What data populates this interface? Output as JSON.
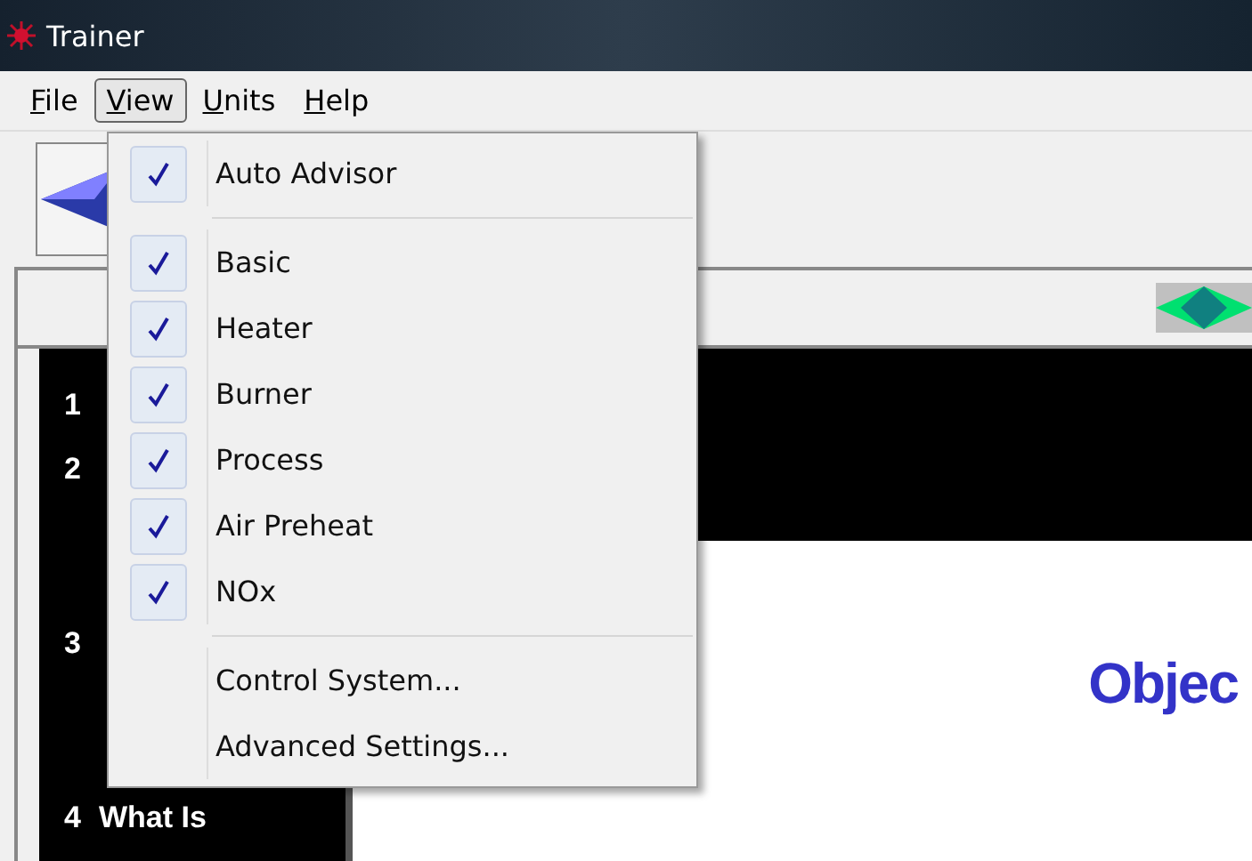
{
  "window": {
    "title": "Trainer"
  },
  "menubar": [
    {
      "label": "File",
      "selected": false
    },
    {
      "label": "View",
      "selected": true
    },
    {
      "label": "Units",
      "selected": false
    },
    {
      "label": "Help",
      "selected": false
    }
  ],
  "view_menu": [
    {
      "kind": "check",
      "label": "Auto Advisor",
      "checked": true
    },
    {
      "kind": "separator"
    },
    {
      "kind": "check",
      "label": "Basic",
      "checked": true
    },
    {
      "kind": "check",
      "label": "Heater",
      "checked": true
    },
    {
      "kind": "check",
      "label": "Burner",
      "checked": true
    },
    {
      "kind": "check",
      "label": "Process",
      "checked": true
    },
    {
      "kind": "check",
      "label": "Air Preheat",
      "checked": true
    },
    {
      "kind": "check",
      "label": "NOx",
      "checked": true
    },
    {
      "kind": "separator"
    },
    {
      "kind": "command",
      "label": "Control System..."
    },
    {
      "kind": "command",
      "label": "Advanced Settings..."
    }
  ],
  "sidebar": {
    "items": [
      {
        "number": "1"
      },
      {
        "number": "2"
      },
      {
        "number": "3"
      },
      {
        "number": "4",
        "label": "What Is"
      }
    ]
  },
  "content": {
    "heading": "Objec"
  }
}
